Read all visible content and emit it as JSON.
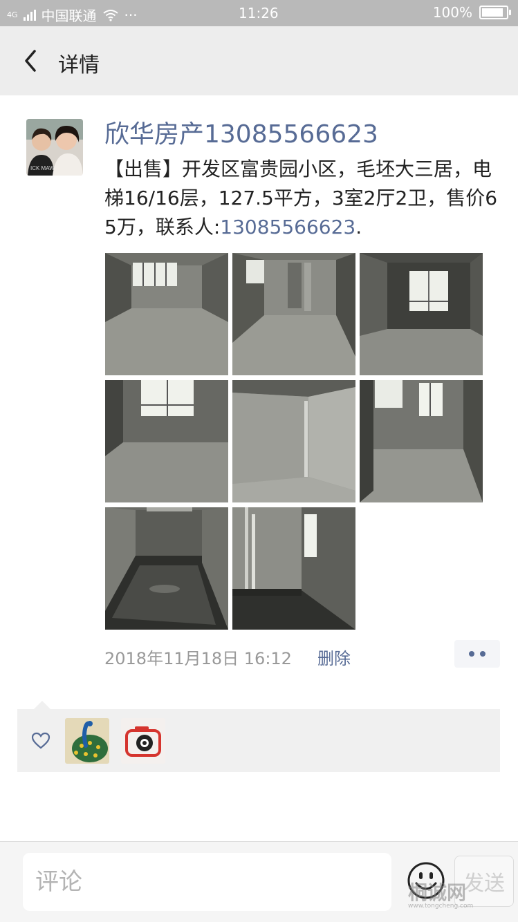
{
  "status_bar": {
    "network": "4G",
    "carrier": "中国联通",
    "more": "···",
    "time": "11:26",
    "battery": "100%",
    "battery_level": 1.0
  },
  "nav": {
    "title": "详情",
    "back_icon": "chevron-left-icon"
  },
  "post": {
    "author": "欣华房产13085566623",
    "text_before_phone": "【出售】开发区富贵园小区，毛坯大三居，电梯16/16层，127.5平方，3室2厅2卫，售价65万，联系人:",
    "phone": "13085566623",
    "text_after_phone": ".",
    "photo_count": 8,
    "timestamp": "2018年11月18日 16:12",
    "delete_label": "删除",
    "more_icon": "more-dots-icon"
  },
  "likes": {
    "icon": "heart-icon",
    "users": [
      "peacock-avatar",
      "camera-logo-avatar"
    ]
  },
  "composer": {
    "placeholder": "评论",
    "emoji_icon": "smiley-icon",
    "send_label": "发送"
  },
  "watermark": {
    "text": "桐诚网",
    "url": "www.tongcheng.com"
  },
  "colors": {
    "link": "#576b95",
    "status_bar": "#b9b9b9",
    "nav_bar": "#ededed",
    "likes_bg": "#f0f0f0"
  }
}
